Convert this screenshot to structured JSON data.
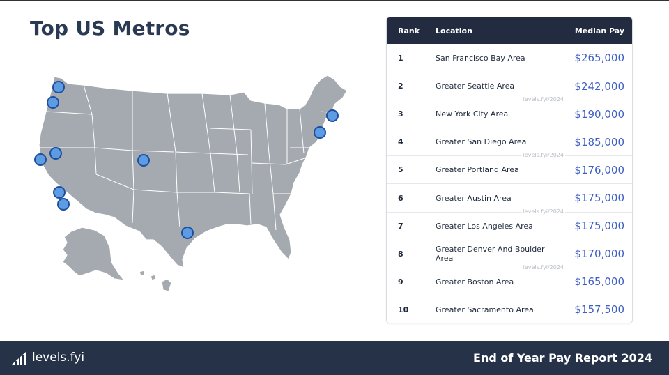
{
  "page": {
    "title": "Top US Metros"
  },
  "map": {
    "metros": [
      {
        "name": "Greater Seattle Area"
      },
      {
        "name": "Greater Portland Area"
      },
      {
        "name": "San Francisco Bay Area"
      },
      {
        "name": "Greater Sacramento Area"
      },
      {
        "name": "Greater Los Angeles Area"
      },
      {
        "name": "Greater San Diego Area"
      },
      {
        "name": "Greater Denver And Boulder Area"
      },
      {
        "name": "Greater Austin Area"
      },
      {
        "name": "New York City Area"
      },
      {
        "name": "Greater Boston Area"
      }
    ],
    "land_color": "#a4aab0",
    "dot_color": "#5d9be3",
    "dot_stroke_color": "#1d4f9e"
  },
  "table": {
    "headers": {
      "rank": "Rank",
      "location": "Location",
      "pay": "Median Pay"
    },
    "watermark": "levels.fyi/2024",
    "rows": [
      {
        "rank": "1",
        "location": "San Francisco Bay Area",
        "pay": "$265,000"
      },
      {
        "rank": "2",
        "location": "Greater Seattle Area",
        "pay": "$242,000"
      },
      {
        "rank": "3",
        "location": "New York City Area",
        "pay": "$190,000"
      },
      {
        "rank": "4",
        "location": "Greater San Diego Area",
        "pay": "$185,000"
      },
      {
        "rank": "5",
        "location": "Greater Portland Area",
        "pay": "$176,000"
      },
      {
        "rank": "6",
        "location": "Greater Austin Area",
        "pay": "$175,000"
      },
      {
        "rank": "7",
        "location": "Greater Los Angeles Area",
        "pay": "$175,000"
      },
      {
        "rank": "8",
        "location": "Greater Denver And Boulder Area",
        "pay": "$170,000"
      },
      {
        "rank": "9",
        "location": "Greater Boston Area",
        "pay": "$165,000"
      },
      {
        "rank": "10",
        "location": "Greater Sacramento Area",
        "pay": "$157,500"
      }
    ],
    "header_bg": "#222b40",
    "pay_color": "#3d5fc4"
  },
  "footer": {
    "logo_text": "levels.fyi",
    "report_title": "End of Year Pay Report 2024",
    "bg_color": "#253248"
  }
}
